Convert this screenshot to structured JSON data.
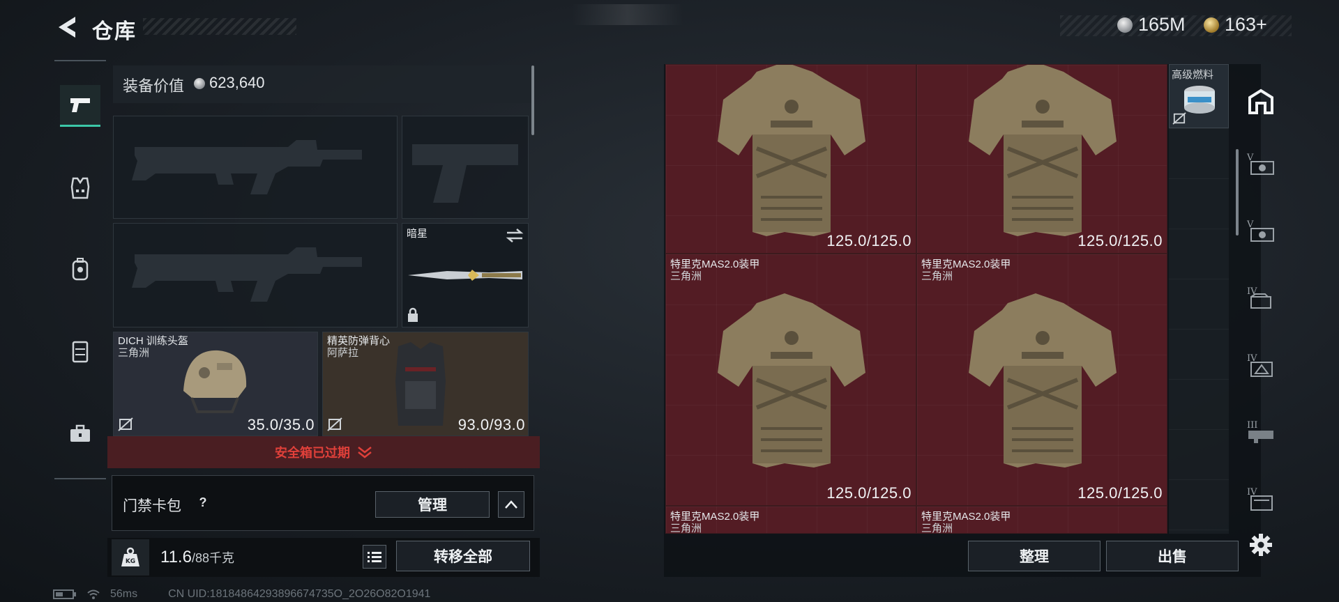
{
  "header": {
    "title": "仓库",
    "currencies": [
      {
        "icon": "silver-coin-icon",
        "value": "165M"
      },
      {
        "icon": "gold-coin-icon",
        "value": "163+"
      }
    ]
  },
  "left_rail": {
    "items": [
      {
        "icon": "pistol-icon",
        "active": true
      },
      {
        "icon": "vest-icon",
        "active": false
      },
      {
        "icon": "backpack-icon",
        "active": false
      },
      {
        "icon": "rig-icon",
        "active": false
      },
      {
        "icon": "toolbox-icon",
        "active": false
      }
    ]
  },
  "equipment": {
    "value_label": "装备价值",
    "value": "623,640",
    "melee": {
      "name": "暗星"
    },
    "helmet": {
      "name": "DICH 训练头盔",
      "source": "三角洲",
      "durability": "35.0/35.0"
    },
    "vest": {
      "name": "精英防弹背心",
      "source": "阿萨拉",
      "durability": "93.0/93.0"
    }
  },
  "safe_box": {
    "text": "安全箱已过期"
  },
  "keycard": {
    "label": "门禁卡包",
    "help": "?",
    "manage": "管理"
  },
  "weight": {
    "icon_text": "KG",
    "current": "11.6",
    "max": "/88千克"
  },
  "transfer_all": "转移全部",
  "status": {
    "latency": "56ms",
    "uid": "CN UID:18184864293896674735O_2O26O82O1941"
  },
  "storage": {
    "items": [
      {
        "name": "",
        "source": "",
        "durability": "125.0/125.0"
      },
      {
        "name": "",
        "source": "",
        "durability": "125.0/125.0"
      },
      {
        "name": "特里克MAS2.0装甲",
        "source": "三角洲",
        "durability": "125.0/125.0"
      },
      {
        "name": "特里克MAS2.0装甲",
        "source": "三角洲",
        "durability": "125.0/125.0"
      },
      {
        "name": "特里克MAS2.0装甲",
        "source": "三角洲",
        "durability": ""
      },
      {
        "name": "特里克MAS2.0装甲",
        "source": "三角洲",
        "durability": ""
      }
    ],
    "fuel": {
      "name": "高级燃料"
    },
    "right_filters": [
      {
        "icon": "home-icon"
      },
      {
        "icon": "tier-5-case-icon",
        "label": "V"
      },
      {
        "icon": "tier-5-case-icon",
        "label": "V"
      },
      {
        "icon": "tier-4-case-icon",
        "label": "IV"
      },
      {
        "icon": "tier-4-case-icon",
        "label": "IV"
      },
      {
        "icon": "tier-3-case-icon",
        "label": "III"
      },
      {
        "icon": "tier-4-case-icon",
        "label": "IV"
      },
      {
        "icon": "settings-icon"
      }
    ]
  },
  "actions": {
    "organize": "整理",
    "sell": "出售"
  },
  "colors": {
    "accent": "#3cc8a8",
    "warning": "#e0403a",
    "cell_bg": "#531c24"
  }
}
